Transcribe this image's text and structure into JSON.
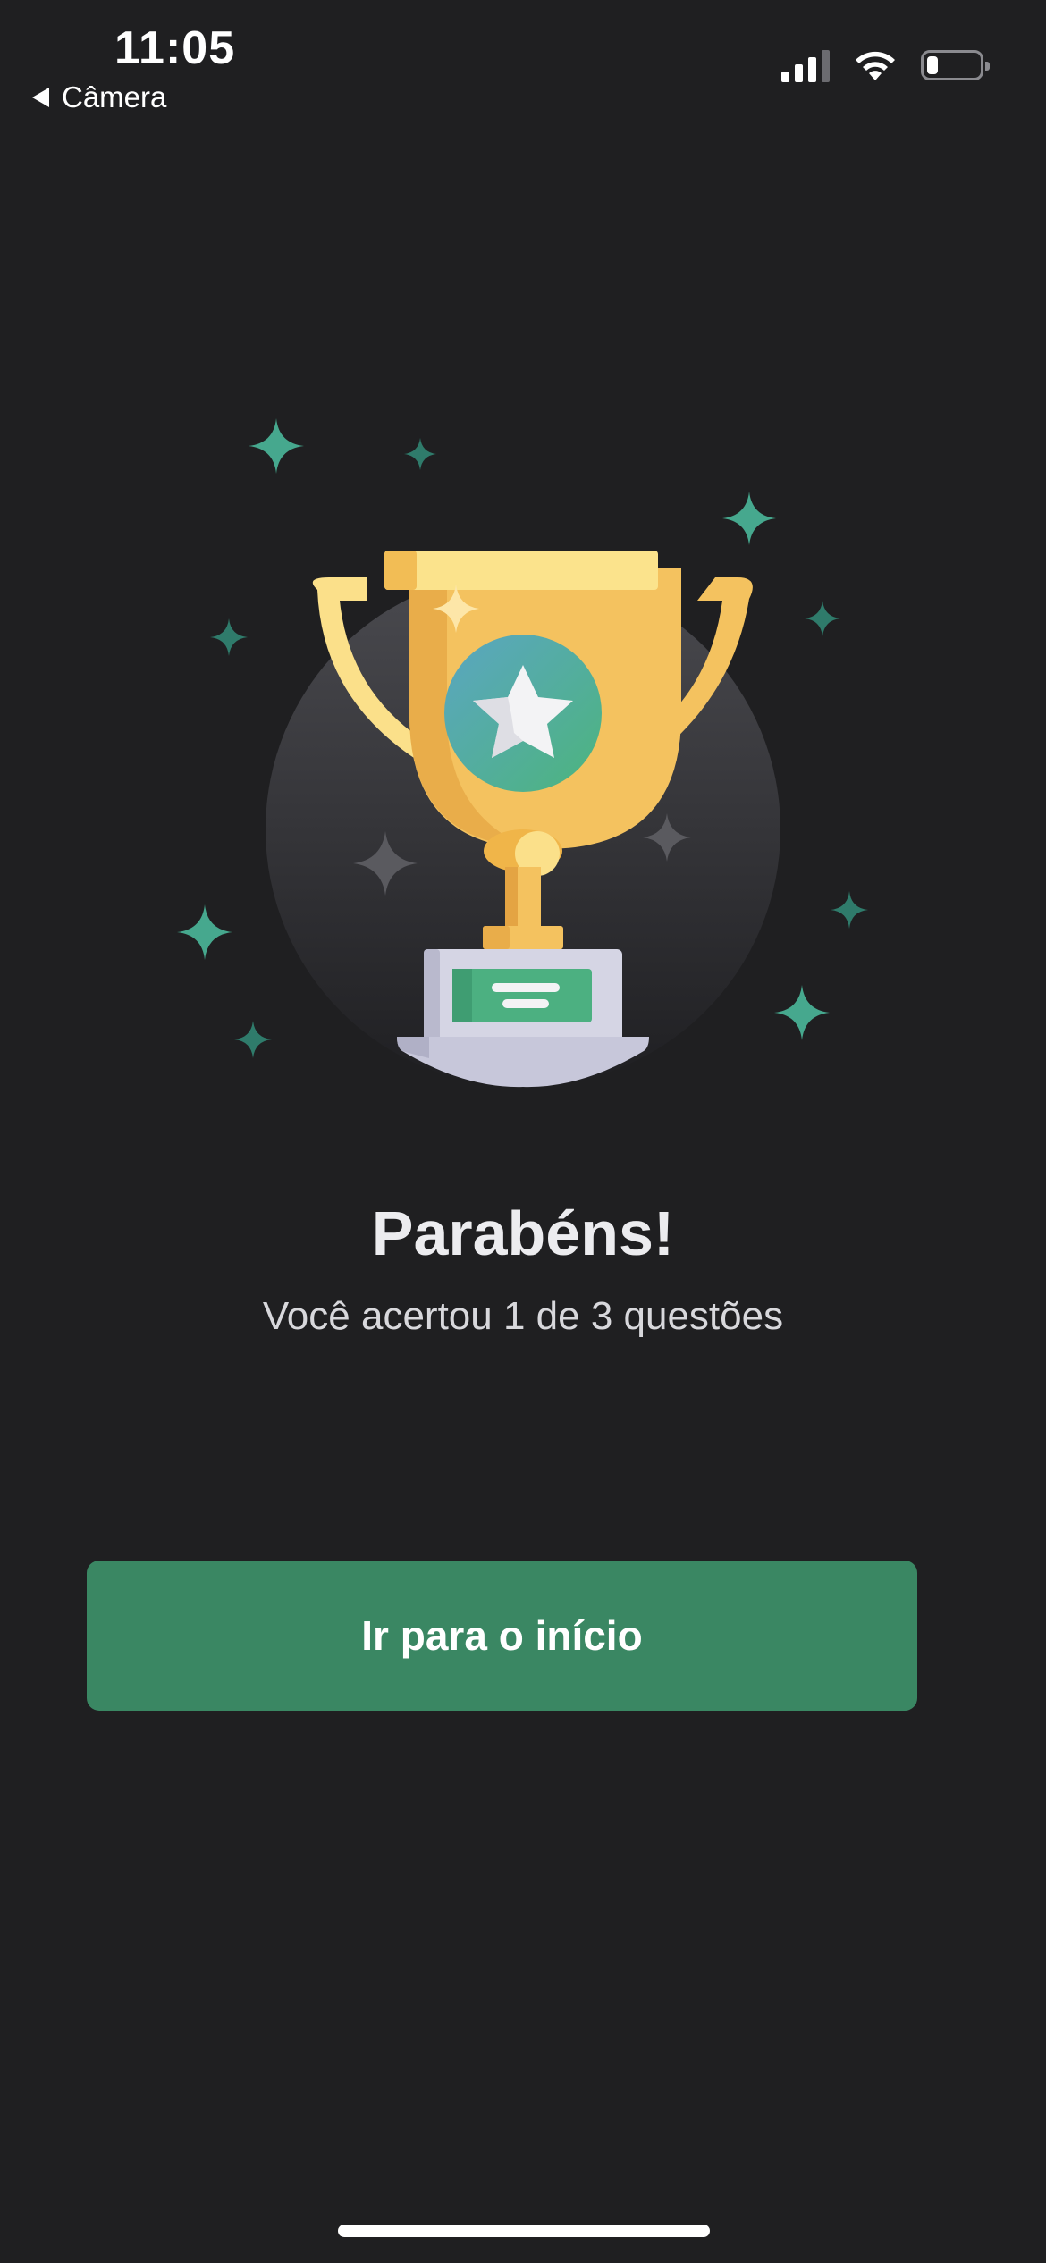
{
  "status_bar": {
    "time": "11:05",
    "back_label": "Câmera",
    "icons": [
      "cellular-signal-icon",
      "wifi-icon",
      "battery-icon"
    ],
    "battery_level_fraction": 0.15
  },
  "illustration": {
    "name": "trophy-icon",
    "colors": {
      "gold": "#f4c25f",
      "gold_light": "#fbe38c",
      "gold_dark": "#e8a847",
      "medal_green": "#4fb286",
      "medal_blue": "#5aa8bc",
      "sparkle": "#3f9c85",
      "base": "#c9c9dc"
    }
  },
  "result": {
    "title": "Parabéns!",
    "message": "Você acertou 1 de 3 questões",
    "correct": 1,
    "total": 3
  },
  "actions": {
    "home_label": "Ir para o início"
  },
  "colors": {
    "background": "#1f1f21",
    "primary_button": "#3a8763",
    "text": "#ffffff"
  }
}
